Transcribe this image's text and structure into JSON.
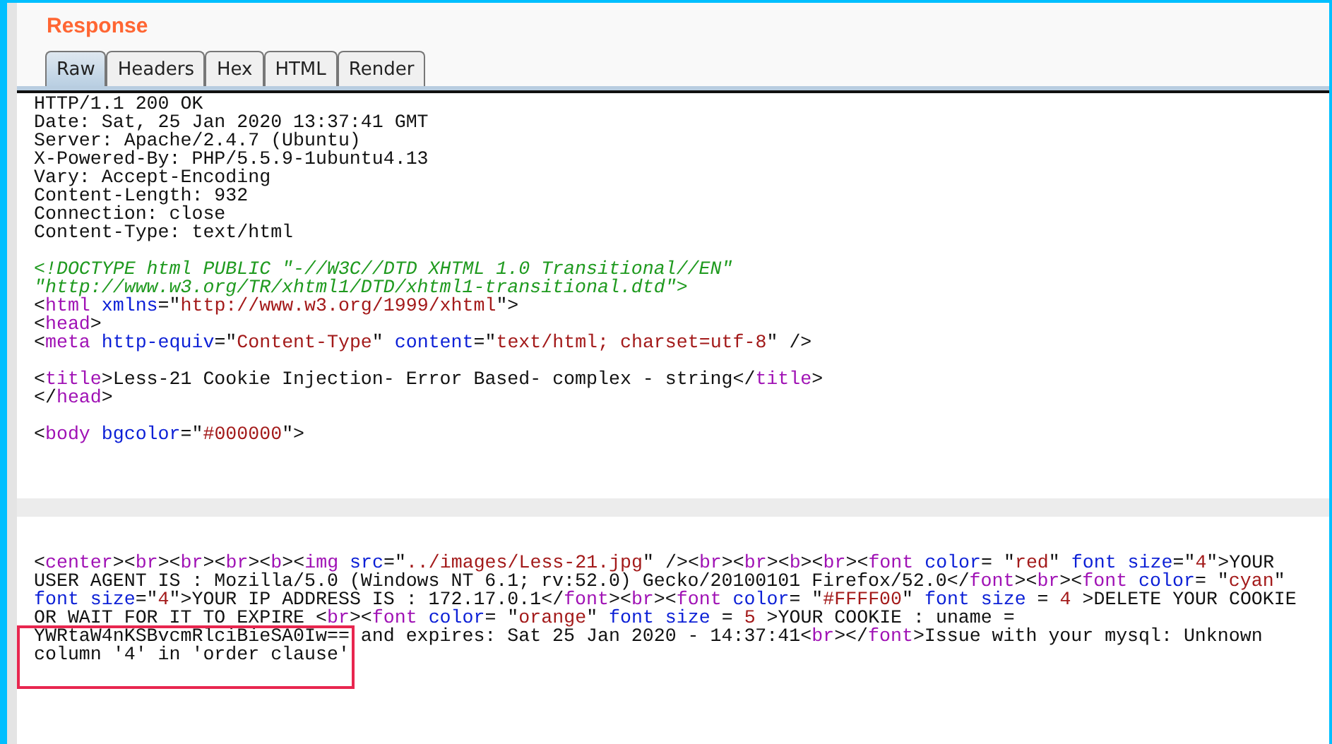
{
  "panel": {
    "title": "Response"
  },
  "tabs": [
    {
      "label": "Raw",
      "selected": true
    },
    {
      "label": "Headers",
      "selected": false
    },
    {
      "label": "Hex",
      "selected": false
    },
    {
      "label": "HTML",
      "selected": false
    },
    {
      "label": "Render",
      "selected": false
    }
  ],
  "code_lines": [
    {
      "kind": "code",
      "parts": [
        {
          "kind": "plain",
          "text": "HTTP/1.1 200 OK"
        }
      ]
    },
    {
      "kind": "code",
      "parts": [
        {
          "kind": "plain",
          "text": "Date: Sat, 25 Jan 2020 13:37:41 GMT"
        }
      ]
    },
    {
      "kind": "code",
      "parts": [
        {
          "kind": "plain",
          "text": "Server: Apache/2.4.7 (Ubuntu)"
        }
      ]
    },
    {
      "kind": "code",
      "parts": [
        {
          "kind": "plain",
          "text": "X-Powered-By: PHP/5.5.9-1ubuntu4.13"
        }
      ]
    },
    {
      "kind": "code",
      "parts": [
        {
          "kind": "plain",
          "text": "Vary: Accept-Encoding"
        }
      ]
    },
    {
      "kind": "code",
      "parts": [
        {
          "kind": "plain",
          "text": "Content-Length: 932"
        }
      ]
    },
    {
      "kind": "code",
      "parts": [
        {
          "kind": "plain",
          "text": "Connection: close"
        }
      ]
    },
    {
      "kind": "code",
      "parts": [
        {
          "kind": "plain",
          "text": "Content-Type: text/html"
        }
      ]
    },
    {
      "kind": "blank"
    },
    {
      "kind": "code",
      "parts": [
        {
          "kind": "comment",
          "text": "<!DOCTYPE html PUBLIC \"-//W3C//DTD XHTML 1.0 Transitional//EN\""
        }
      ]
    },
    {
      "kind": "code",
      "parts": [
        {
          "kind": "comment",
          "text": "\"http://www.w3.org/TR/xhtml1/DTD/xhtml1-transitional.dtd\">"
        }
      ]
    },
    {
      "kind": "code",
      "parts": [
        {
          "kind": "plain",
          "text": "<"
        },
        {
          "kind": "tag",
          "text": "html "
        },
        {
          "kind": "attr",
          "text": "xmlns"
        },
        {
          "kind": "plain",
          "text": "=\""
        },
        {
          "kind": "value",
          "text": "http://www.w3.org/1999/xhtml"
        },
        {
          "kind": "plain",
          "text": "\">"
        }
      ]
    },
    {
      "kind": "code",
      "parts": [
        {
          "kind": "plain",
          "text": "<"
        },
        {
          "kind": "tag",
          "text": "head"
        },
        {
          "kind": "plain",
          "text": ">"
        }
      ]
    },
    {
      "kind": "code",
      "parts": [
        {
          "kind": "plain",
          "text": "<"
        },
        {
          "kind": "tag",
          "text": "meta "
        },
        {
          "kind": "attr",
          "text": "http-equiv"
        },
        {
          "kind": "plain",
          "text": "=\""
        },
        {
          "kind": "value",
          "text": "Content-Type"
        },
        {
          "kind": "plain",
          "text": "\" "
        },
        {
          "kind": "attr",
          "text": "content"
        },
        {
          "kind": "plain",
          "text": "=\""
        },
        {
          "kind": "value",
          "text": "text/html; charset=utf-8"
        },
        {
          "kind": "plain",
          "text": "\" />"
        }
      ]
    },
    {
      "kind": "blank"
    },
    {
      "kind": "code",
      "parts": [
        {
          "kind": "plain",
          "text": "<"
        },
        {
          "kind": "tag",
          "text": "title"
        },
        {
          "kind": "plain",
          "text": ">Less-21 Cookie Injection- Error Based- complex - string</"
        },
        {
          "kind": "tag",
          "text": "title"
        },
        {
          "kind": "plain",
          "text": ">"
        }
      ]
    },
    {
      "kind": "code",
      "parts": [
        {
          "kind": "plain",
          "text": "</"
        },
        {
          "kind": "tag",
          "text": "head"
        },
        {
          "kind": "plain",
          "text": ">"
        }
      ]
    },
    {
      "kind": "blank"
    },
    {
      "kind": "code",
      "parts": [
        {
          "kind": "plain",
          "text": "<"
        },
        {
          "kind": "tag",
          "text": "body "
        },
        {
          "kind": "attr",
          "text": "bgcolor"
        },
        {
          "kind": "plain",
          "text": "=\""
        },
        {
          "kind": "value",
          "text": "#000000"
        },
        {
          "kind": "plain",
          "text": "\">"
        }
      ]
    },
    {
      "kind": "blank"
    },
    {
      "kind": "blank"
    },
    {
      "kind": "blank"
    },
    {
      "kind": "current_line"
    },
    {
      "kind": "blank"
    },
    {
      "kind": "blank"
    },
    {
      "kind": "code",
      "parts": [
        {
          "kind": "plain",
          "text": "<"
        },
        {
          "kind": "tag",
          "text": "center"
        },
        {
          "kind": "plain",
          "text": "><"
        },
        {
          "kind": "tag",
          "text": "br"
        },
        {
          "kind": "plain",
          "text": "><"
        },
        {
          "kind": "tag",
          "text": "br"
        },
        {
          "kind": "plain",
          "text": "><"
        },
        {
          "kind": "tag",
          "text": "br"
        },
        {
          "kind": "plain",
          "text": "><"
        },
        {
          "kind": "tag",
          "text": "b"
        },
        {
          "kind": "plain",
          "text": "><"
        },
        {
          "kind": "tag",
          "text": "img "
        },
        {
          "kind": "attr",
          "text": "src"
        },
        {
          "kind": "plain",
          "text": "=\""
        },
        {
          "kind": "value",
          "text": "../images/Less-21.jpg"
        },
        {
          "kind": "plain",
          "text": "\" /><"
        },
        {
          "kind": "tag",
          "text": "br"
        },
        {
          "kind": "plain",
          "text": "><"
        },
        {
          "kind": "tag",
          "text": "br"
        },
        {
          "kind": "plain",
          "text": "><"
        },
        {
          "kind": "tag",
          "text": "b"
        },
        {
          "kind": "plain",
          "text": "><"
        },
        {
          "kind": "tag",
          "text": "br"
        },
        {
          "kind": "plain",
          "text": "><"
        },
        {
          "kind": "tag",
          "text": "font "
        },
        {
          "kind": "attr",
          "text": "color"
        },
        {
          "kind": "plain",
          "text": "= \""
        },
        {
          "kind": "value",
          "text": "red"
        },
        {
          "kind": "plain",
          "text": "\" "
        },
        {
          "kind": "attr",
          "text": "font size"
        },
        {
          "kind": "plain",
          "text": "=\""
        },
        {
          "kind": "value",
          "text": "4"
        },
        {
          "kind": "plain",
          "text": "\">YOUR"
        }
      ]
    },
    {
      "kind": "code",
      "parts": [
        {
          "kind": "plain",
          "text": "USER AGENT IS : Mozilla/5.0 (Windows NT 6.1; rv:52.0) Gecko/20100101 Firefox/52.0</"
        },
        {
          "kind": "tag",
          "text": "font"
        },
        {
          "kind": "plain",
          "text": "><"
        },
        {
          "kind": "tag",
          "text": "br"
        },
        {
          "kind": "plain",
          "text": "><"
        },
        {
          "kind": "tag",
          "text": "font "
        },
        {
          "kind": "attr",
          "text": "color"
        },
        {
          "kind": "plain",
          "text": "= \""
        },
        {
          "kind": "value",
          "text": "cyan"
        },
        {
          "kind": "plain",
          "text": "\""
        }
      ]
    },
    {
      "kind": "code",
      "parts": [
        {
          "kind": "attr",
          "text": "font size"
        },
        {
          "kind": "plain",
          "text": "=\""
        },
        {
          "kind": "value",
          "text": "4"
        },
        {
          "kind": "plain",
          "text": "\">YOUR IP ADDRESS IS : 172.17.0.1</"
        },
        {
          "kind": "tag",
          "text": "font"
        },
        {
          "kind": "plain",
          "text": "><"
        },
        {
          "kind": "tag",
          "text": "br"
        },
        {
          "kind": "plain",
          "text": "><"
        },
        {
          "kind": "tag",
          "text": "font "
        },
        {
          "kind": "attr",
          "text": "color"
        },
        {
          "kind": "plain",
          "text": "= \""
        },
        {
          "kind": "value",
          "text": "#FFFF00"
        },
        {
          "kind": "plain",
          "text": "\" "
        },
        {
          "kind": "attr",
          "text": "font size"
        },
        {
          "kind": "plain",
          "text": " = "
        },
        {
          "kind": "value",
          "text": "4"
        },
        {
          "kind": "plain",
          "text": " >DELETE YOUR COOKIE"
        }
      ]
    },
    {
      "kind": "code",
      "parts": [
        {
          "kind": "plain",
          "text": "OR WAIT FOR IT TO EXPIRE <"
        },
        {
          "kind": "tag",
          "text": "br"
        },
        {
          "kind": "plain",
          "text": "><"
        },
        {
          "kind": "tag",
          "text": "font "
        },
        {
          "kind": "attr",
          "text": "color"
        },
        {
          "kind": "plain",
          "text": "= \""
        },
        {
          "kind": "value",
          "text": "orange"
        },
        {
          "kind": "plain",
          "text": "\" "
        },
        {
          "kind": "attr",
          "text": "font size"
        },
        {
          "kind": "plain",
          "text": " = "
        },
        {
          "kind": "value",
          "text": "5"
        },
        {
          "kind": "plain",
          "text": " >YOUR COOKIE : uname ="
        }
      ]
    },
    {
      "kind": "code",
      "parts": [
        {
          "kind": "plain",
          "text": "YWRtaW4nKSBvcmRlciBieSA0Iw== and expires: Sat 25 Jan 2020 - 14:37:41<"
        },
        {
          "kind": "tag",
          "text": "br"
        },
        {
          "kind": "plain",
          "text": "></"
        },
        {
          "kind": "tag",
          "text": "font"
        },
        {
          "kind": "plain",
          "text": ">Issue with your mysql: Unknown"
        }
      ]
    },
    {
      "kind": "code",
      "parts": [
        {
          "kind": "plain",
          "text": "column '4' in 'order clause'"
        }
      ]
    }
  ]
}
